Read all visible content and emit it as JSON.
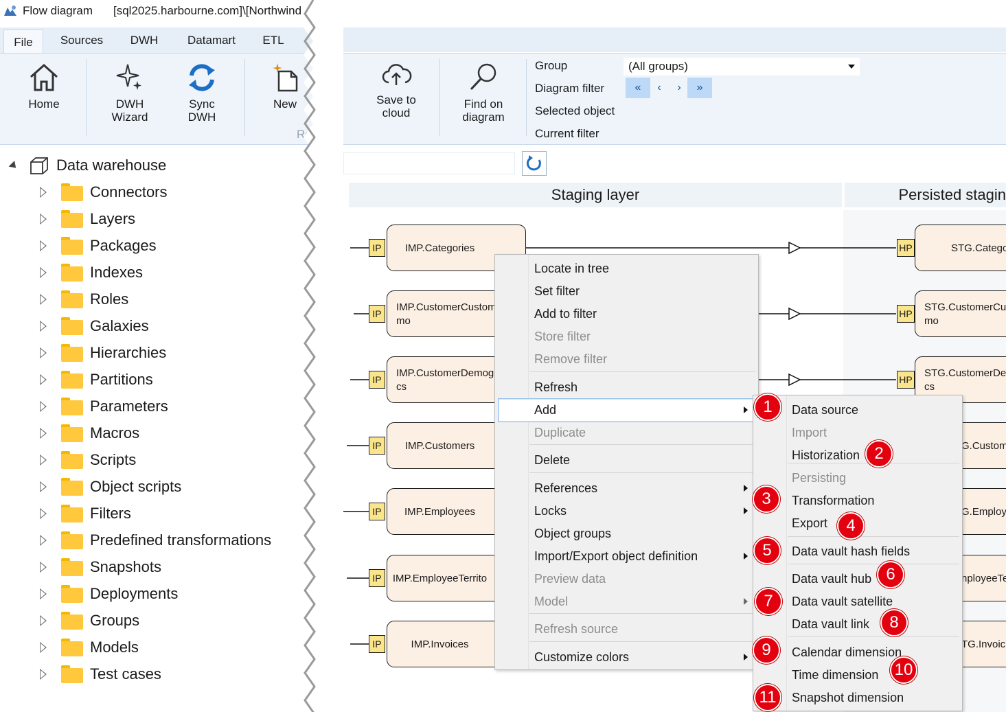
{
  "window": {
    "app_title": "Flow diagram",
    "connection": "[sql2025.harbourne.com]\\[Northwind"
  },
  "ribbon": {
    "tabs": [
      "File",
      "Sources",
      "DWH",
      "Datamart",
      "ETL"
    ],
    "active_tab": "File",
    "buttons": {
      "home": "Home",
      "dwh_wizard_1": "DWH",
      "dwh_wizard_2": "Wizard",
      "sync_dwh_1": "Sync",
      "sync_dwh_2": "DWH",
      "new": "New",
      "group_fragment": "Re",
      "save_cloud_1": "Save to",
      "save_cloud_2": "cloud",
      "find_1": "Find on",
      "find_2": "diagram"
    },
    "filters": {
      "group_label": "Group",
      "group_value": "(All groups)",
      "diagram_filter_label": "Diagram filter",
      "selected_object_label": "Selected object",
      "current_filter_label": "Current filter",
      "nav": [
        "«",
        "‹",
        "›",
        "»"
      ]
    }
  },
  "tree": {
    "root": "Data warehouse",
    "items": [
      "Connectors",
      "Layers",
      "Packages",
      "Indexes",
      "Roles",
      "Galaxies",
      "Hierarchies",
      "Partitions",
      "Parameters",
      "Macros",
      "Scripts",
      "Object scripts",
      "Filters",
      "Predefined transformations",
      "Snapshots",
      "Deployments",
      "Groups",
      "Models",
      "Test cases"
    ]
  },
  "diagram": {
    "columns": {
      "staging": "Staging layer",
      "persisted": "Persisted stagin"
    },
    "left_nodes": [
      {
        "tag": "IP",
        "line1": "IMP.Categories",
        "line2": ""
      },
      {
        "tag": "IP",
        "line1": "IMP.CustomerCustom",
        "line2": "mo"
      },
      {
        "tag": "IP",
        "line1": "IMP.CustomerDemog",
        "line2": "cs"
      },
      {
        "tag": "IP",
        "line1": "IMP.Customers",
        "line2": ""
      },
      {
        "tag": "IP",
        "line1": "IMP.Employees",
        "line2": ""
      },
      {
        "tag": "IP",
        "line1": "IMP.EmployeeTerrito",
        "line2": ""
      },
      {
        "tag": "IP",
        "line1": "IMP.Invoices",
        "line2": ""
      }
    ],
    "right_nodes": [
      {
        "tag": "HP",
        "line1": "STG.Categor",
        "line2": ""
      },
      {
        "tag": "HP",
        "line1": "STG.CustomerCus",
        "line2": "mo"
      },
      {
        "tag": "HP",
        "line1": "STG.CustomerDer",
        "line2": "cs"
      },
      {
        "tag": "",
        "line1": "G.Custom",
        "line2": ""
      },
      {
        "tag": "",
        "line1": "G.Employ",
        "line2": ""
      },
      {
        "tag": "",
        "line1": "nployeeTe",
        "line2": ""
      },
      {
        "tag": "",
        "line1": "TG.Invoic",
        "line2": ""
      }
    ]
  },
  "context_menu": {
    "items": [
      "Locate in tree",
      "Set filter",
      "Add to filter",
      "Store filter",
      "Remove filter",
      "Refresh",
      "Add",
      "Duplicate",
      "Delete",
      "References",
      "Locks",
      "Object groups",
      "Import/Export object definition",
      "Preview data",
      "Model",
      "Refresh source",
      "Customize colors"
    ]
  },
  "submenu": {
    "items": [
      "Data source",
      "Import",
      "Historization",
      "Persisting",
      "Transformation",
      "Export",
      "Data vault hash fields",
      "Data vault hub",
      "Data vault satellite",
      "Data vault link",
      "Calendar dimension",
      "Time dimension",
      "Snapshot dimension"
    ]
  },
  "badges": [
    "1",
    "2",
    "3",
    "4",
    "5",
    "6",
    "7",
    "8",
    "9",
    "10",
    "11"
  ],
  "colors": {
    "accent": "#1b6fc4",
    "badge": "#e3000f",
    "node_fill": "#fcefe3",
    "tag_fill": "#fbe58a",
    "folder": "#ffc83d"
  }
}
